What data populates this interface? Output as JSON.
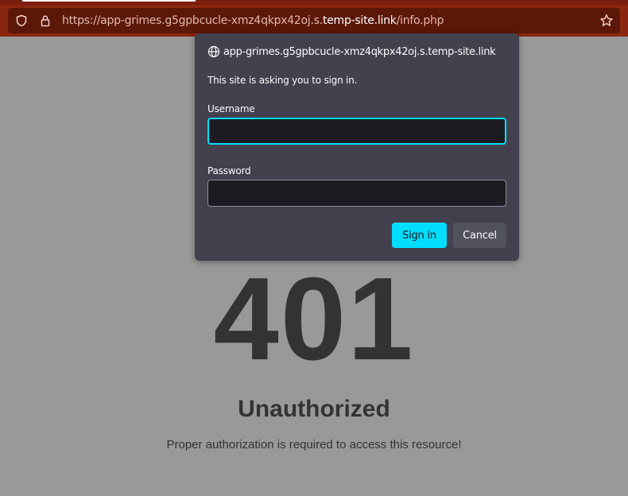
{
  "browser": {
    "url_prefix": "https://app-grimes.g5gpbcucle-xmz4qkpx42oj.s.",
    "url_domain": "temp-site.link",
    "url_path": "/info.php",
    "icons": {
      "tracking": "shield-icon",
      "security": "lock-icon",
      "bookmark": "star-icon"
    }
  },
  "auth_dialog": {
    "site": "app-grimes.g5gpbcucle-xmz4qkpx42oj.s.temp-site.link",
    "message": "This site is asking you to sign in.",
    "username_label": "Username",
    "username_value": "",
    "password_label": "Password",
    "password_value": "",
    "signin_label": "Sign in",
    "cancel_label": "Cancel",
    "icon": "globe-icon"
  },
  "page": {
    "code": "401",
    "reason": "Unauthorized",
    "description": "Proper authorization is required to access this resource!"
  },
  "colors": {
    "toolbar": "#8a2610",
    "urlbar": "#5b1707",
    "dialog_bg": "#42414d",
    "accent": "#00ddff",
    "page_bg": "#999999",
    "page_text": "#333333"
  }
}
